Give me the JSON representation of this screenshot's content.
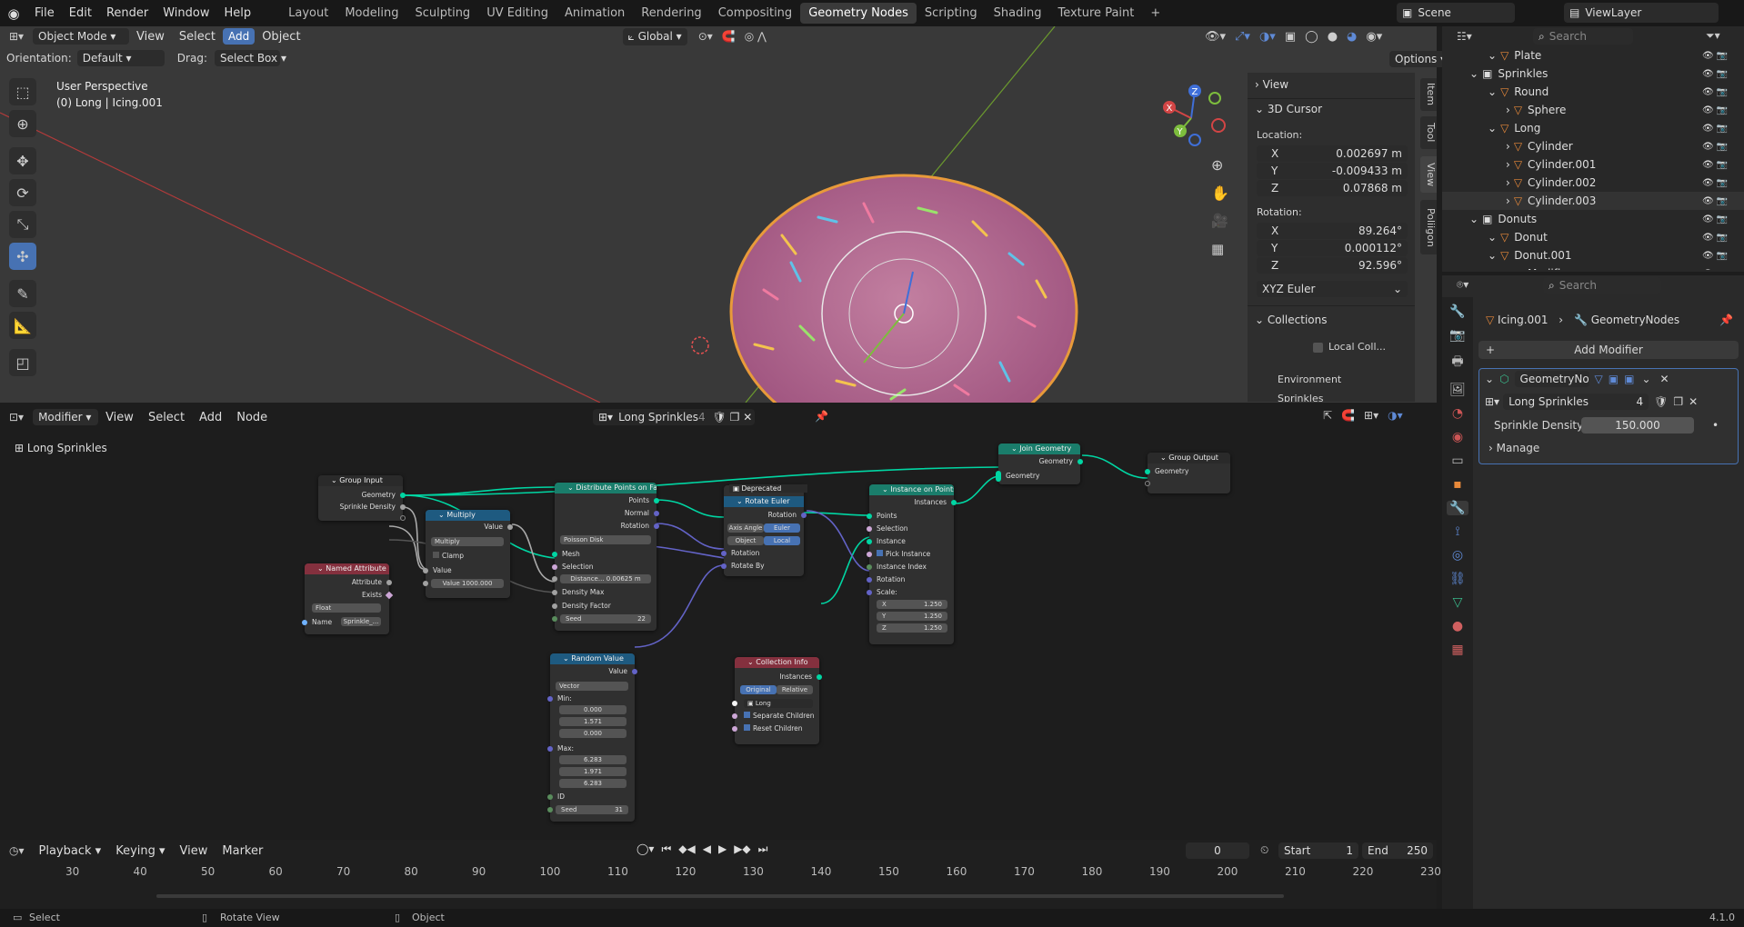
{
  "topbar": {
    "menus": [
      "File",
      "Edit",
      "Render",
      "Window",
      "Help"
    ],
    "workspaces": [
      "Layout",
      "Modeling",
      "Sculpting",
      "UV Editing",
      "Animation",
      "Rendering",
      "Compositing",
      "Geometry Nodes",
      "Scripting",
      "Shading",
      "Texture Paint"
    ],
    "scene": "Scene",
    "viewlayer": "ViewLayer"
  },
  "viewport": {
    "mode": "Object Mode",
    "menus": [
      "View",
      "Select",
      "Add",
      "Object"
    ],
    "transform": "Global",
    "orientation_label": "Orientation:",
    "orientation_value": "Default",
    "drag_label": "Drag:",
    "drag_value": "Select Box",
    "options": "Options",
    "overlay_line1": "User Perspective",
    "overlay_line2": "(0) Long | Icing.001"
  },
  "npanel": {
    "view": "View",
    "cursor": "3D Cursor",
    "location": "Location:",
    "loc": [
      {
        "axis": "X",
        "value": "0.002697 m"
      },
      {
        "axis": "Y",
        "value": "-0.009433 m"
      },
      {
        "axis": "Z",
        "value": "0.07868 m"
      }
    ],
    "rotation": "Rotation:",
    "rot": [
      {
        "axis": "X",
        "value": "89.264°"
      },
      {
        "axis": "Y",
        "value": "0.000112°"
      },
      {
        "axis": "Z",
        "value": "92.596°"
      }
    ],
    "euler": "XYZ Euler",
    "collections": "Collections",
    "local": "Local Coll...",
    "environment": "Environment",
    "sprinkles": "Sprinkles",
    "tabs": [
      "Item",
      "Tool",
      "View",
      "Poliigon"
    ]
  },
  "outliner": {
    "search": "Search",
    "rows": [
      {
        "label": "Plate",
        "depth": 1
      },
      {
        "label": "Sprinkles",
        "depth": 0
      },
      {
        "label": "Round",
        "depth": 1
      },
      {
        "label": "Sphere",
        "depth": 2
      },
      {
        "label": "Long",
        "depth": 1
      },
      {
        "label": "Cylinder",
        "depth": 2
      },
      {
        "label": "Cylinder.001",
        "depth": 2
      },
      {
        "label": "Cylinder.002",
        "depth": 2
      },
      {
        "label": "Cylinder.003",
        "depth": 2
      },
      {
        "label": "Donuts",
        "depth": 0
      },
      {
        "label": "Donut",
        "depth": 1
      },
      {
        "label": "Donut.001",
        "depth": 1
      },
      {
        "label": "Modifiers",
        "depth": 2
      }
    ]
  },
  "properties": {
    "search": "Search",
    "object": "Icing.001",
    "modifier_path": "GeometryNodes",
    "add_modifier": "Add Modifier",
    "modifier_name": "GeometryNo...",
    "nodegroup": "Long Sprinkles",
    "users": "4",
    "density_label": "Sprinkle Density",
    "density_value": "150.000",
    "manage": "Manage"
  },
  "nodeeditor": {
    "mode": "Modifier",
    "menus": [
      "View",
      "Select",
      "Add",
      "Node"
    ],
    "group": "Long Sprinkles",
    "users": "4",
    "breadcrumb": "Long Sprinkles",
    "nodes": {
      "group_input": {
        "title": "Group Input",
        "geometry": "Geometry",
        "density": "Sprinkle Density"
      },
      "multiply": {
        "title": "Multiply",
        "value_out": "Value",
        "op": "Multiply",
        "clamp": "Clamp",
        "value": "Value",
        "value_field": "Value  1000.000"
      },
      "named_attr": {
        "title": "Named Attribute",
        "attribute": "Attribute",
        "exists": "Exists",
        "type": "Float",
        "name_label": "Name",
        "name_value": "Sprinkle_..."
      },
      "distribute": {
        "title": "Distribute Points on Faces",
        "points": "Points",
        "normal": "Normal",
        "rotation": "Rotation",
        "method": "Poisson Disk",
        "mesh": "Mesh",
        "selection": "Selection",
        "distance": "Distance...  0.00625 m",
        "density_max": "Density Max",
        "density_factor": "Density Factor",
        "seed_label": "Seed",
        "seed": "22"
      },
      "rotate": {
        "deprecated": "Deprecated",
        "title": "Rotate Euler",
        "rotation_out": "Rotation",
        "axis_angle": "Axis Angle",
        "euler": "Euler",
        "object": "Object",
        "local": "Local",
        "rotation": "Rotation",
        "rotate_by": "Rotate By"
      },
      "instance": {
        "title": "Instance on Points",
        "instances": "Instances",
        "points": "Points",
        "selection": "Selection",
        "instance": "Instance",
        "pick": "Pick Instance",
        "index": "Instance Index",
        "rotation": "Rotation",
        "scale": "Scale:",
        "sx": "X",
        "sy": "Y",
        "sz": "Z",
        "scale_value": "1.250"
      },
      "join": {
        "title": "Join Geometry",
        "geometry_out": "Geometry",
        "geometry_in": "Geometry"
      },
      "output": {
        "title": "Group Output",
        "geometry": "Geometry"
      },
      "random": {
        "title": "Random Value",
        "value": "Value",
        "type": "Vector",
        "min": "Min:",
        "min_vals": [
          "0.000",
          "1.571",
          "0.000"
        ],
        "max": "Max:",
        "max_vals": [
          "6.283",
          "1.971",
          "6.283"
        ],
        "id": "ID",
        "seed_label": "Seed",
        "seed": "31"
      },
      "collection": {
        "title": "Collection Info",
        "instances": "Instances",
        "original": "Original",
        "relative": "Relative",
        "name": "Long",
        "sep": "Separate Children",
        "reset": "Reset Children"
      }
    }
  },
  "timeline": {
    "menus": [
      "Playback",
      "Keying",
      "View",
      "Marker"
    ],
    "frame": "0",
    "start_label": "Start",
    "start": "1",
    "end_label": "End",
    "end": "250",
    "ticks": [
      "30",
      "40",
      "50",
      "60",
      "70",
      "80",
      "90",
      "100",
      "110",
      "120",
      "130",
      "140",
      "150",
      "160",
      "170",
      "180",
      "190",
      "200",
      "210",
      "220",
      "230"
    ]
  },
  "statusbar": {
    "select": "Select",
    "rotate": "Rotate View",
    "object": "Object",
    "version": "4.1.0"
  },
  "colors": {
    "accent": "#4772b3",
    "geo_node": "#1a7d6b",
    "converter": "#1e5a80",
    "input": "#84303e",
    "socket_geo": "#00d6a3"
  }
}
